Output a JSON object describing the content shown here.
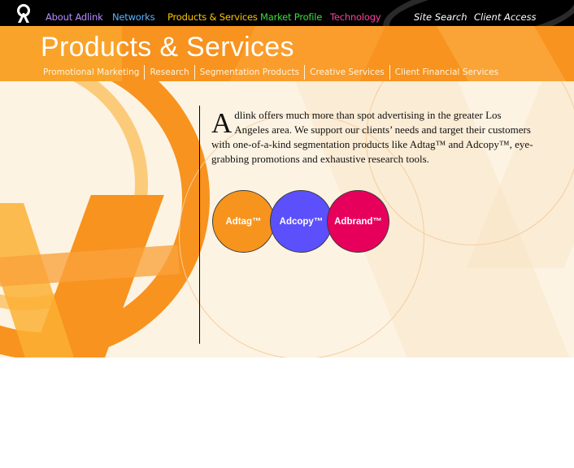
{
  "colors": {
    "accent_orange": "#f7931e",
    "nav_black": "#000000",
    "adtag": "#f7941d",
    "adcopy": "#5b50fb",
    "adbrand": "#e6005c"
  },
  "nav": {
    "logo_icon": "adlink-logo-icon",
    "items": [
      {
        "label": "About Adlink",
        "color": "#b48cff"
      },
      {
        "label": "Networks",
        "color": "#5ab4ff"
      },
      {
        "label": "Products & Services",
        "color": "#ffc400"
      },
      {
        "label": "Market Profile",
        "color": "#3cdc3c"
      },
      {
        "label": "Technology",
        "color": "#ff3fa0"
      }
    ],
    "site_search": "Site Search",
    "client_access": "Client Access"
  },
  "banner": {
    "title": "Products & Services",
    "subnav": [
      "Promotional Marketing",
      "Research",
      "Segmentation Products",
      "Creative Services",
      "Client Financial Services"
    ]
  },
  "content": {
    "dropcap": "A",
    "intro": "dlink offers much more than spot advertising in the greater Los Angeles area. We support our clients’ needs and target their customers with one-of-a-kind segmentation products like Adtag™ and Adcopy™, eye-grabbing promotions and exhaustive research tools.",
    "products": [
      "Adtag™",
      "Adcopy™",
      "Adbrand™"
    ]
  }
}
